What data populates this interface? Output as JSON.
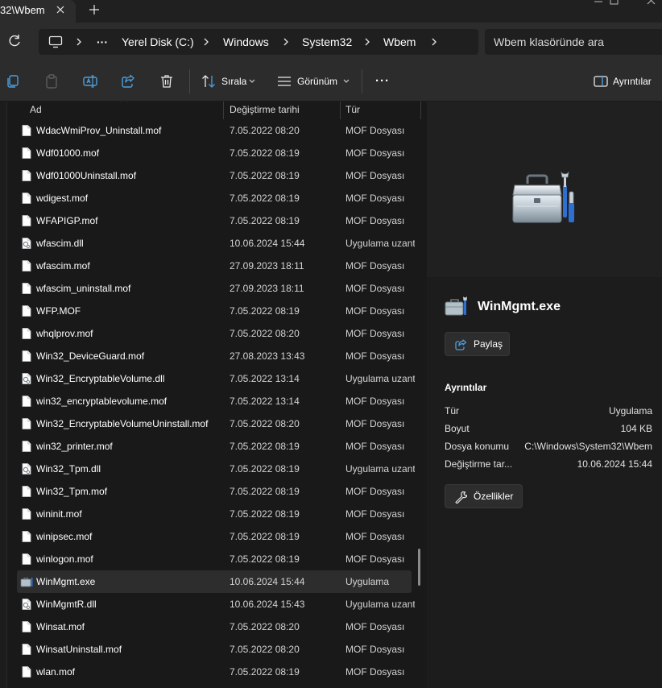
{
  "window": {
    "tab_title": "32\\Wbem"
  },
  "address": {
    "crumbs": [
      "Yerel Disk (C:)",
      "Windows",
      "System32",
      "Wbem"
    ],
    "overflow": "···",
    "search_placeholder": "Wbem klasöründe ara"
  },
  "toolbar": {
    "sort_label": "Sırala",
    "view_label": "Görünüm",
    "more_label": "···",
    "details_label": "Ayrıntılar"
  },
  "columns": {
    "name": "Ad",
    "modified": "Değiştirme tarihi",
    "type": "Tür"
  },
  "files": [
    {
      "name": "WdacWmiProv_Uninstall.mof",
      "date": "7.05.2022 08:20",
      "type": "MOF Dosyası",
      "icon": "mof-file-icon"
    },
    {
      "name": "Wdf01000.mof",
      "date": "7.05.2022 08:19",
      "type": "MOF Dosyası",
      "icon": "mof-file-icon"
    },
    {
      "name": "Wdf01000Uninstall.mof",
      "date": "7.05.2022 08:19",
      "type": "MOF Dosyası",
      "icon": "mof-file-icon"
    },
    {
      "name": "wdigest.mof",
      "date": "7.05.2022 08:19",
      "type": "MOF Dosyası",
      "icon": "mof-file-icon"
    },
    {
      "name": "WFAPIGP.mof",
      "date": "7.05.2022 08:19",
      "type": "MOF Dosyası",
      "icon": "mof-file-icon"
    },
    {
      "name": "wfascim.dll",
      "date": "10.06.2024 15:44",
      "type": "Uygulama uzantısı",
      "icon": "dll-file-icon"
    },
    {
      "name": "wfascim.mof",
      "date": "27.09.2023 18:11",
      "type": "MOF Dosyası",
      "icon": "mof-file-icon"
    },
    {
      "name": "wfascim_uninstall.mof",
      "date": "27.09.2023 18:11",
      "type": "MOF Dosyası",
      "icon": "mof-file-icon"
    },
    {
      "name": "WFP.MOF",
      "date": "7.05.2022 08:19",
      "type": "MOF Dosyası",
      "icon": "mof-file-icon"
    },
    {
      "name": "whqlprov.mof",
      "date": "7.05.2022 08:20",
      "type": "MOF Dosyası",
      "icon": "mof-file-icon"
    },
    {
      "name": "Win32_DeviceGuard.mof",
      "date": "27.08.2023 13:43",
      "type": "MOF Dosyası",
      "icon": "mof-file-icon"
    },
    {
      "name": "Win32_EncryptableVolume.dll",
      "date": "7.05.2022 13:14",
      "type": "Uygulama uzantısı",
      "icon": "dll-file-icon"
    },
    {
      "name": "win32_encryptablevolume.mof",
      "date": "7.05.2022 13:14",
      "type": "MOF Dosyası",
      "icon": "mof-file-icon"
    },
    {
      "name": "Win32_EncryptableVolumeUninstall.mof",
      "date": "7.05.2022 08:20",
      "type": "MOF Dosyası",
      "icon": "mof-file-icon"
    },
    {
      "name": "win32_printer.mof",
      "date": "7.05.2022 08:19",
      "type": "MOF Dosyası",
      "icon": "mof-file-icon"
    },
    {
      "name": "Win32_Tpm.dll",
      "date": "7.05.2022 08:19",
      "type": "Uygulama uzantısı",
      "icon": "dll-file-icon"
    },
    {
      "name": "Win32_Tpm.mof",
      "date": "7.05.2022 08:19",
      "type": "MOF Dosyası",
      "icon": "mof-file-icon"
    },
    {
      "name": "wininit.mof",
      "date": "7.05.2022 08:19",
      "type": "MOF Dosyası",
      "icon": "mof-file-icon"
    },
    {
      "name": "winipsec.mof",
      "date": "7.05.2022 08:19",
      "type": "MOF Dosyası",
      "icon": "mof-file-icon"
    },
    {
      "name": "winlogon.mof",
      "date": "7.05.2022 08:19",
      "type": "MOF Dosyası",
      "icon": "mof-file-icon"
    },
    {
      "name": "WinMgmt.exe",
      "date": "10.06.2024 15:44",
      "type": "Uygulama",
      "icon": "exe-toolbox-icon",
      "selected": true
    },
    {
      "name": "WinMgmtR.dll",
      "date": "10.06.2024 15:43",
      "type": "Uygulama uzantısı",
      "icon": "dll-file-icon"
    },
    {
      "name": "Winsat.mof",
      "date": "7.05.2022 08:20",
      "type": "MOF Dosyası",
      "icon": "mof-file-icon"
    },
    {
      "name": "WinsatUninstall.mof",
      "date": "7.05.2022 08:20",
      "type": "MOF Dosyası",
      "icon": "mof-file-icon"
    },
    {
      "name": "wlan.mof",
      "date": "7.05.2022 08:19",
      "type": "MOF Dosyası",
      "icon": "mof-file-icon"
    }
  ],
  "details": {
    "file_name": "WinMgmt.exe",
    "share_label": "Paylaş",
    "section_title": "Ayrıntılar",
    "properties": [
      {
        "key": "Tür",
        "value": "Uygulama"
      },
      {
        "key": "Boyut",
        "value": "104 KB"
      },
      {
        "key": "Dosya konumu",
        "value": "C:\\Windows\\System32\\Wbem"
      },
      {
        "key": "Değiştirme tar...",
        "value": "10.06.2024 15:44"
      }
    ],
    "properties_button": "Özellikler"
  },
  "colors": {
    "background": "#191919",
    "toolbar": "#2c2c2c",
    "selection": "#2d2d2d",
    "accent": "#4ca0e0"
  }
}
